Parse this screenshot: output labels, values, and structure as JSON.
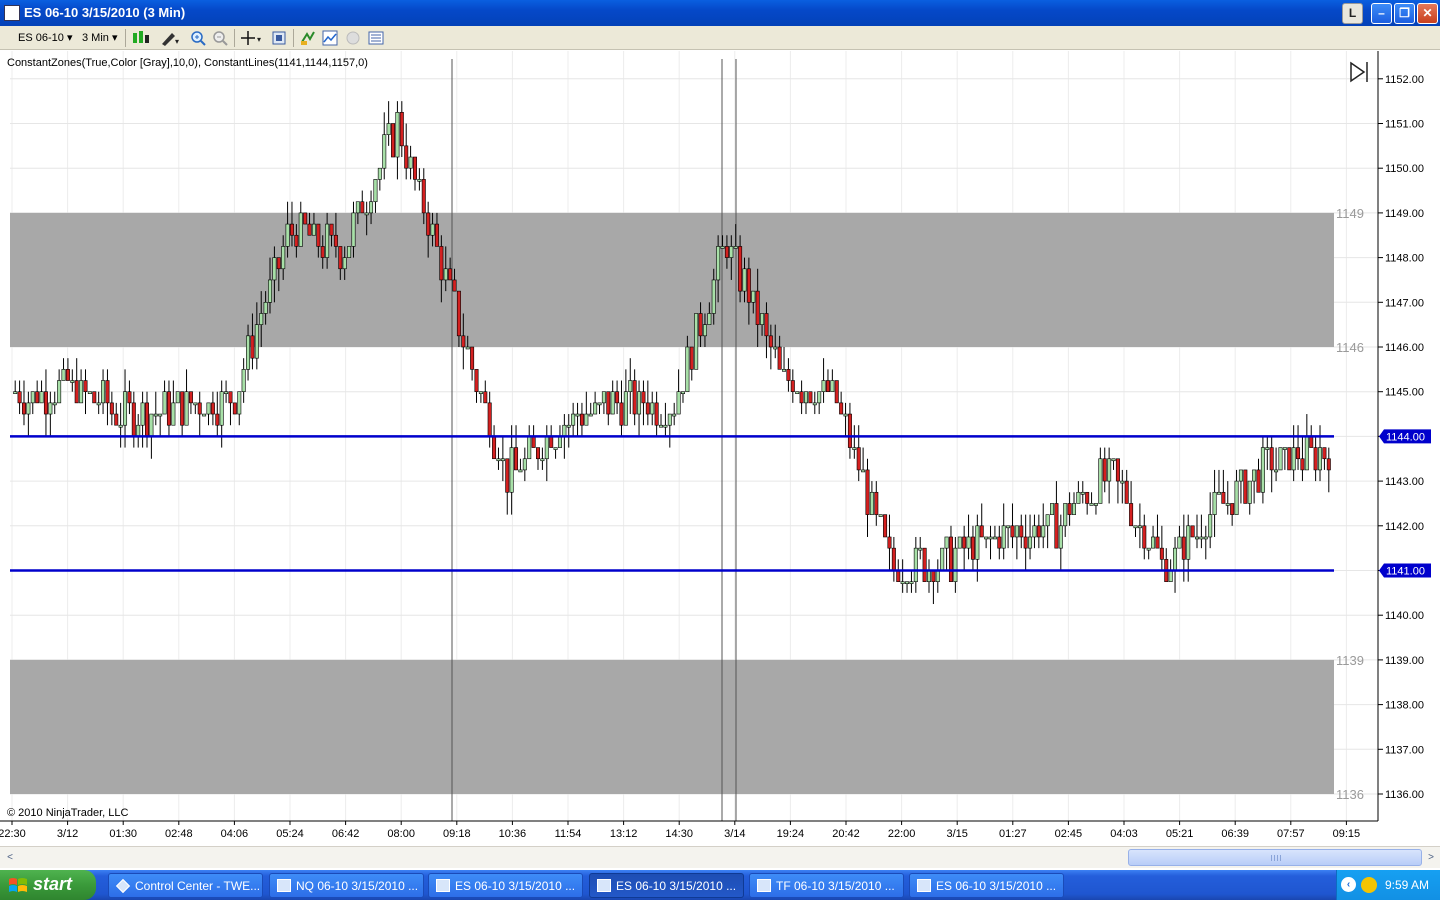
{
  "window": {
    "title": "ES 06-10  3/15/2010 (3 Min)",
    "btn_l": "L"
  },
  "toolbar": {
    "instrument": "ES 06-10",
    "interval": "3 Min"
  },
  "chart": {
    "indicator_text": "ConstantZones(True,Color [Gray],10,0), ConstantLines(1141,1144,1157,0)",
    "copyright": "© 2010 NinjaTrader, LLC",
    "zone_labels": [
      "1149",
      "1146",
      "1139",
      "1136"
    ],
    "price_ticks": [
      "1152.00",
      "1151.00",
      "1150.00",
      "1149.00",
      "1148.00",
      "1147.00",
      "1146.00",
      "1145.00",
      "1144.00",
      "1143.00",
      "1142.00",
      "1141.00",
      "1140.00",
      "1139.00",
      "1138.00",
      "1137.00",
      "1136.00"
    ],
    "line_badges": [
      "1144.00",
      "1141.00"
    ],
    "time_ticks": [
      "22:30",
      "3/12",
      "01:30",
      "02:48",
      "04:06",
      "05:24",
      "06:42",
      "08:00",
      "09:18",
      "10:36",
      "11:54",
      "13:12",
      "14:30",
      "3/14",
      "19:24",
      "20:42",
      "22:00",
      "3/15",
      "01:27",
      "02:45",
      "04:03",
      "05:21",
      "06:39",
      "07:57",
      "09:15"
    ],
    "colors": {
      "up": "#a8e0a8",
      "down": "#d42020",
      "zone": "#a8a8a8",
      "line": "#0000cc"
    }
  },
  "chart_data": {
    "type": "candlestick",
    "zones": [
      [
        1146,
        1149
      ],
      [
        1136,
        1139
      ]
    ],
    "horizontal_lines": [
      1141,
      1144
    ],
    "ylim": [
      1135.65,
      1152.35
    ],
    "x": [
      "22:30",
      "3/12",
      "01:30",
      "02:48",
      "04:06",
      "05:24",
      "06:42",
      "08:00",
      "09:18",
      "10:36",
      "11:54",
      "13:12",
      "14:30",
      "3/14",
      "19:24",
      "20:42",
      "22:00",
      "3/15",
      "01:27",
      "02:45",
      "04:03",
      "05:21",
      "06:39",
      "07:57",
      "09:15"
    ],
    "close": [
      1144.9,
      1145.1,
      1144.5,
      1144.6,
      1144.9,
      1148.6,
      1148.2,
      1151.0,
      1146.9,
      1143.1,
      1144.3,
      1144.8,
      1144.6,
      1148.4,
      1145.3,
      1144.8,
      1141.1,
      1141.2,
      1141.8,
      1142.0,
      1143.2,
      1141.1,
      1142.4,
      1143.4,
      1143.7
    ]
  },
  "scrollbar": {
    "left": "<",
    "right": ">"
  },
  "taskbar": {
    "start": "start",
    "tasks": [
      "Control Center - TWE...",
      "NQ 06-10  3/15/2010 ...",
      "ES 06-10  3/15/2010 ...",
      "ES 06-10  3/15/2010 ...",
      "TF 06-10  3/15/2010 ...",
      "ES 06-10  3/15/2010 ..."
    ],
    "clock": "9:59 AM"
  }
}
